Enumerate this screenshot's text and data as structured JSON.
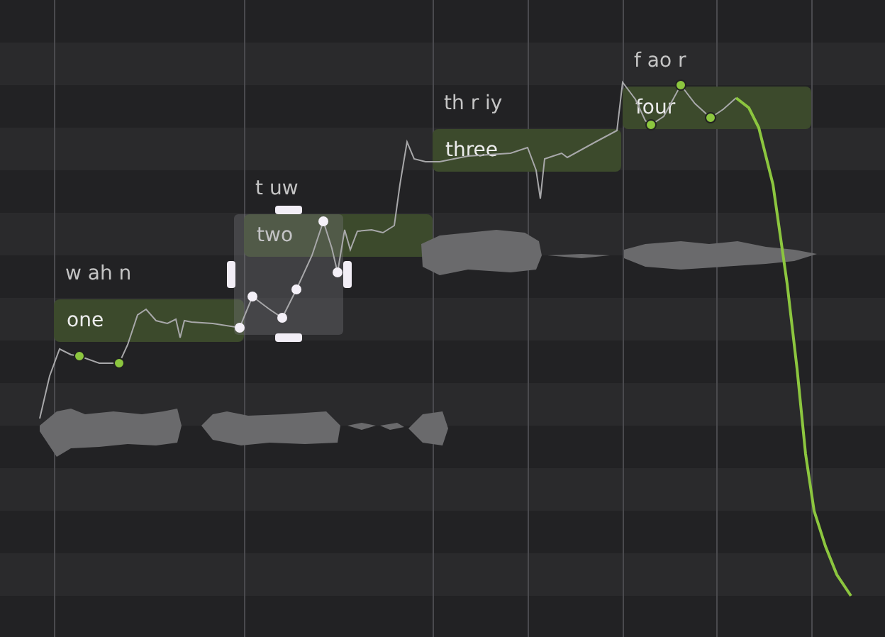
{
  "notes": [
    {
      "lyric": "one",
      "phonemes": "w ah n"
    },
    {
      "lyric": "two",
      "phonemes": "t uw"
    },
    {
      "lyric": "three",
      "phonemes": "th r iy"
    },
    {
      "lyric": "four",
      "phonemes": "f ao r"
    }
  ],
  "pitch_points": [
    {
      "selected": false
    },
    {
      "selected": false
    },
    {
      "selected": true
    },
    {
      "selected": true
    },
    {
      "selected": true
    },
    {
      "selected": true
    },
    {
      "selected": true
    },
    {
      "selected": true
    },
    {
      "selected": false
    },
    {
      "selected": false
    },
    {
      "selected": false
    }
  ]
}
